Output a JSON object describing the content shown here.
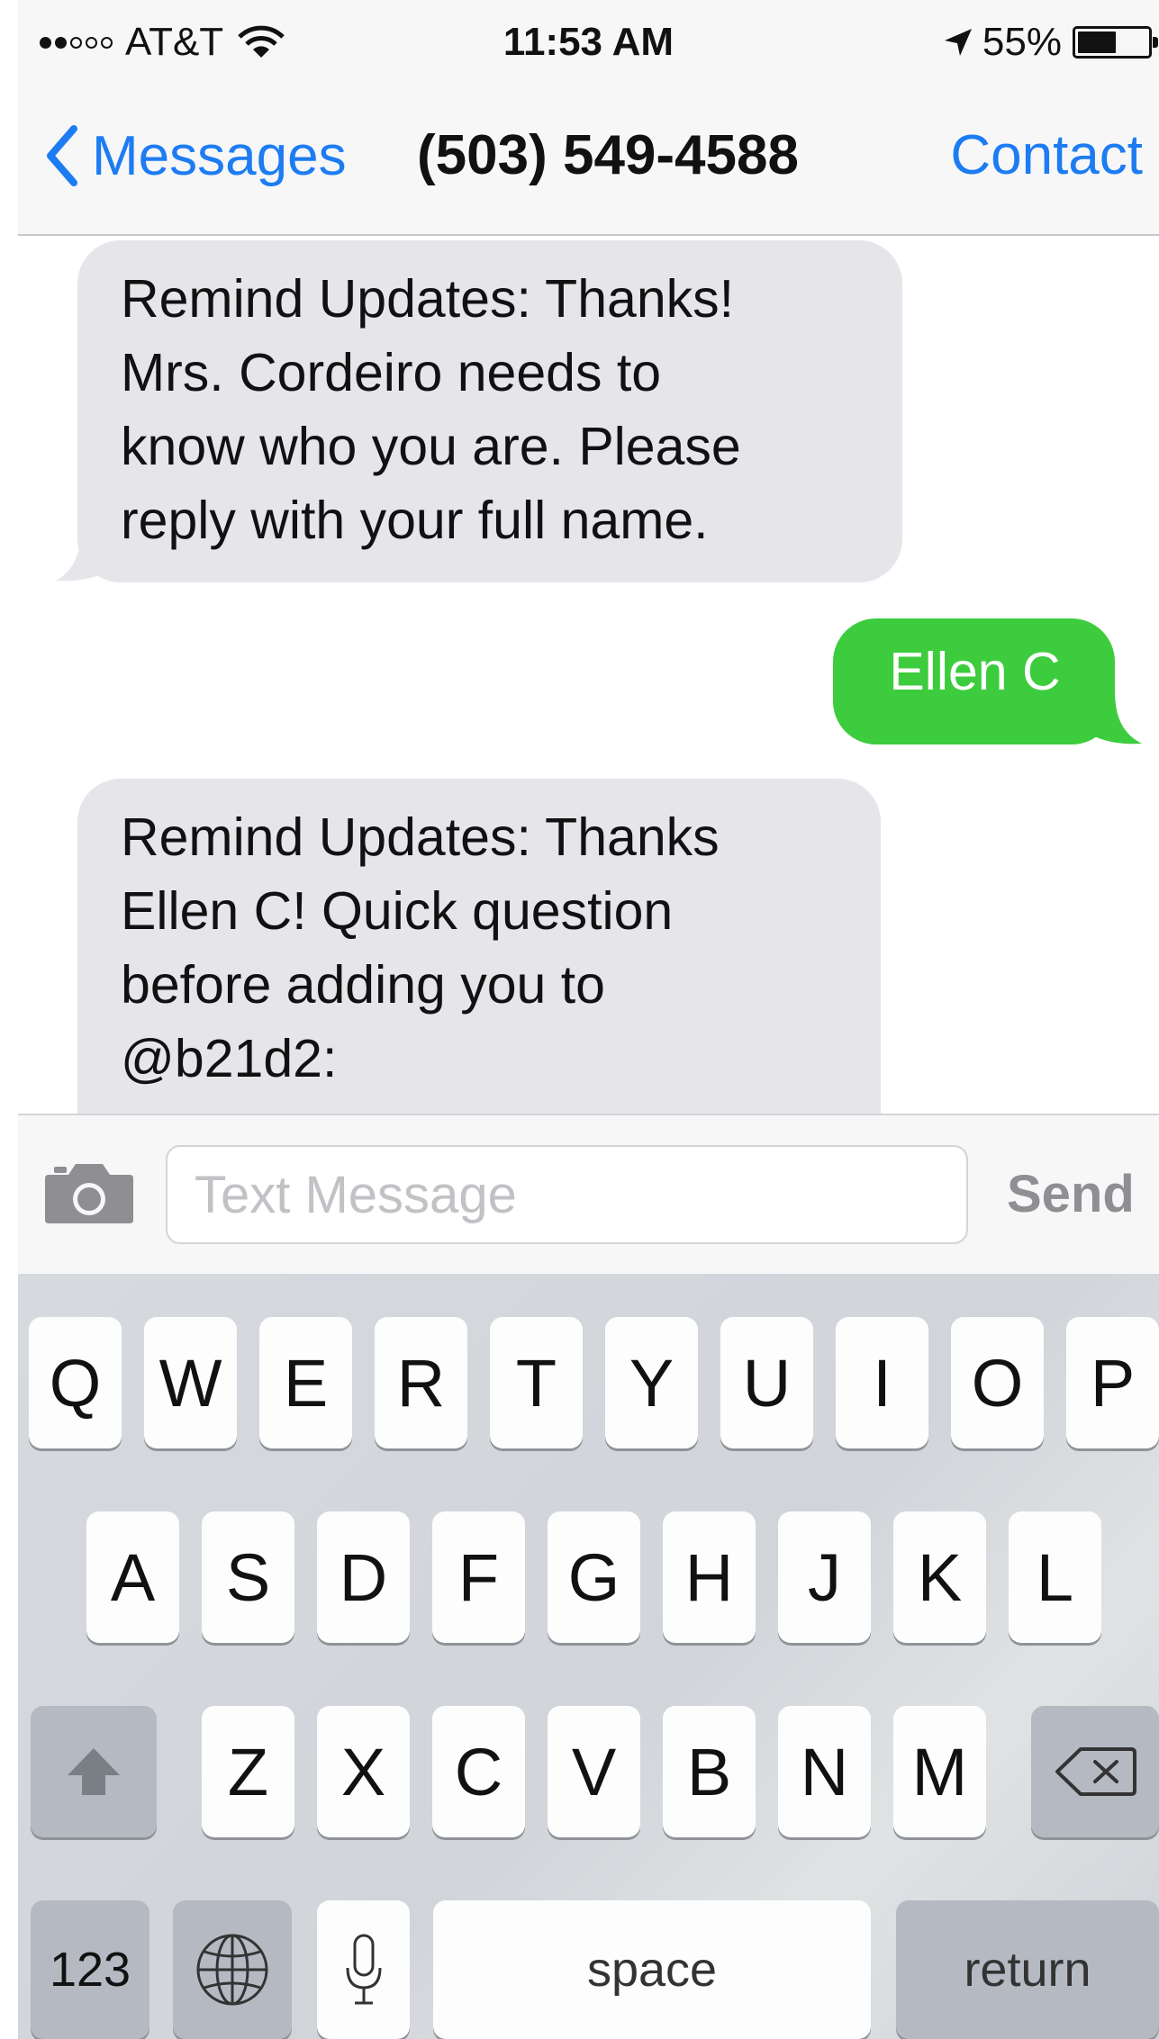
{
  "status_bar": {
    "carrier": "AT&T",
    "signal_bars_filled": 2,
    "signal_bars_total": 5,
    "time": "11:53 AM",
    "battery_percent": "55%",
    "battery_level": 0.55,
    "icons": [
      "wifi-icon",
      "location-arrow-icon",
      "battery-icon"
    ]
  },
  "nav": {
    "back_label": "Messages",
    "title": "(503) 549-4588",
    "contact_label": "Contact"
  },
  "messages": [
    {
      "direction": "received",
      "lines": [
        "Remind Updates: Thanks!",
        "Mrs. Cordeiro needs to",
        "know who you are. Please",
        "reply with your full name."
      ]
    },
    {
      "direction": "sent",
      "lines": [
        "Ellen C"
      ]
    },
    {
      "direction": "received",
      "lines": [
        "Remind Updates: Thanks",
        "Ellen C! Quick question",
        "before adding you to",
        "@b21d2:"
      ]
    }
  ],
  "input_bar": {
    "placeholder": "Text Message",
    "value": "",
    "send_label": "Send"
  },
  "keyboard": {
    "row1": [
      "Q",
      "W",
      "E",
      "R",
      "T",
      "Y",
      "U",
      "I",
      "O",
      "P"
    ],
    "row2": [
      "A",
      "S",
      "D",
      "F",
      "G",
      "H",
      "J",
      "K",
      "L"
    ],
    "row3": [
      "Z",
      "X",
      "C",
      "V",
      "B",
      "N",
      "M"
    ],
    "numbers_label": "123",
    "space_label": "space",
    "return_label": "return"
  },
  "colors": {
    "accent_blue": "#1d7cf2",
    "sent_bubble": "#3dcc3d",
    "received_bubble": "#e5e5ea"
  }
}
